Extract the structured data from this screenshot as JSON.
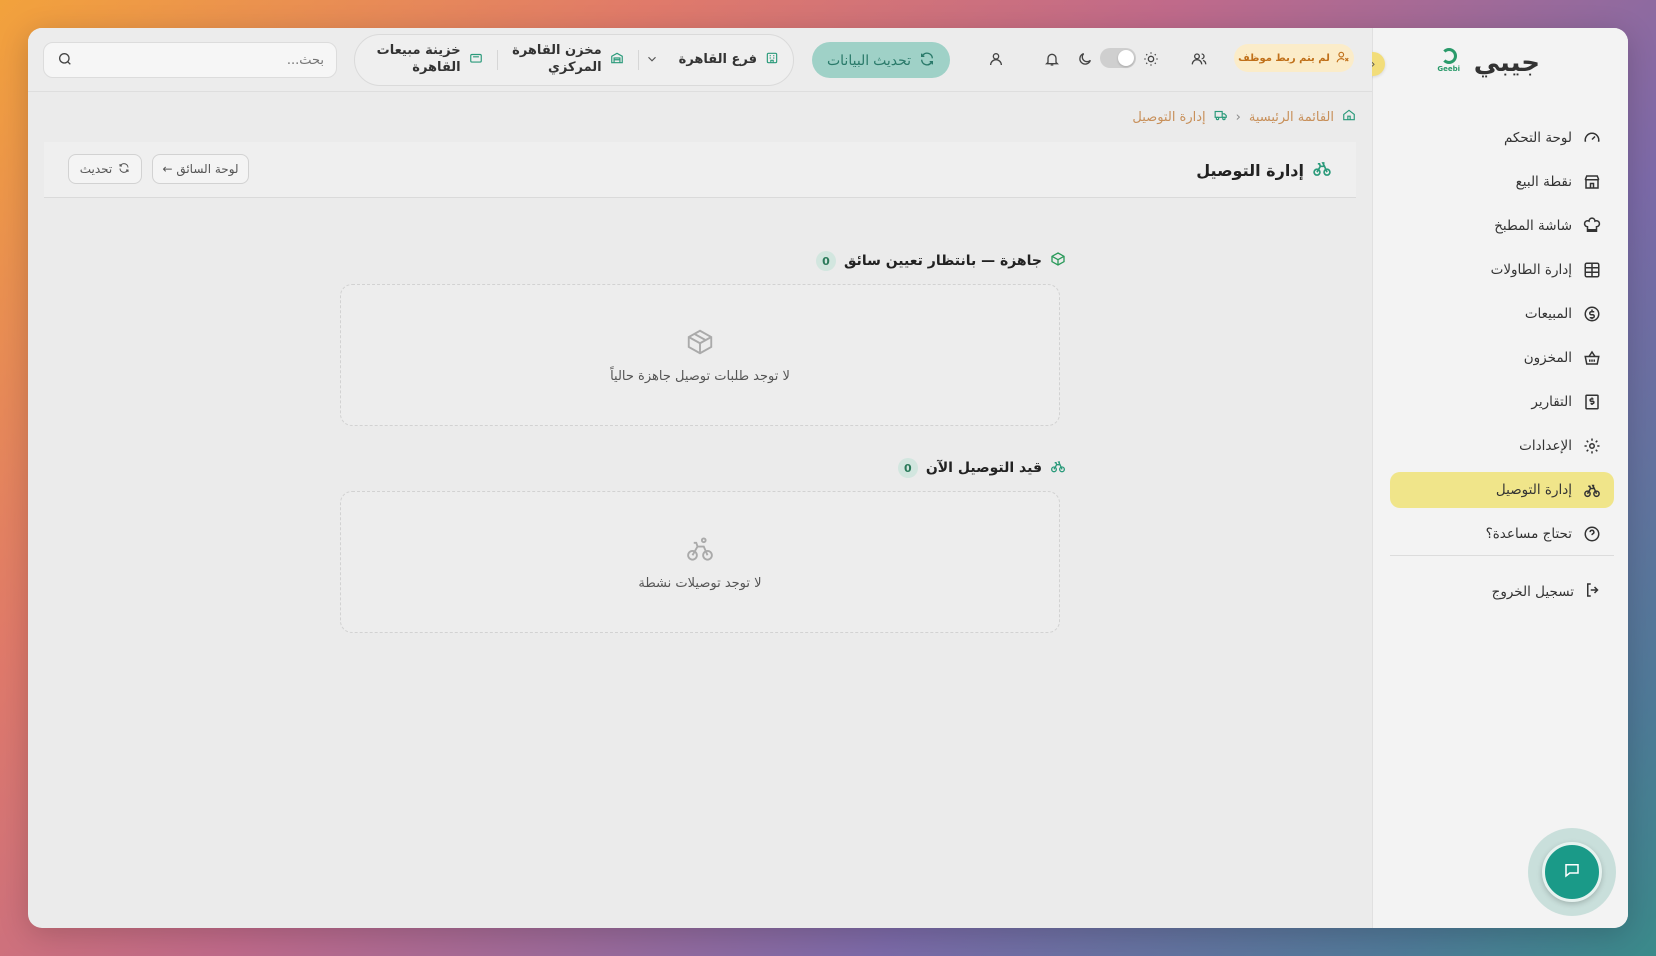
{
  "brand": {
    "name": "جيبي",
    "logo_text": "Geebi"
  },
  "sidebar": {
    "items": [
      {
        "label": "لوحة التحكم",
        "icon": "gauge-icon"
      },
      {
        "label": "نقطة البيع",
        "icon": "store-icon"
      },
      {
        "label": "شاشة المطبخ",
        "icon": "chef-hat-icon"
      },
      {
        "label": "إدارة الطاولات",
        "icon": "table-grid-icon"
      },
      {
        "label": "المبيعات",
        "icon": "dollar-circle-icon"
      },
      {
        "label": "المخزون",
        "icon": "basket-icon"
      },
      {
        "label": "التقارير",
        "icon": "receipt-icon"
      },
      {
        "label": "الإعدادات",
        "icon": "gear-icon"
      },
      {
        "label": "إدارة التوصيل",
        "icon": "bike-icon",
        "active": true
      },
      {
        "label": "تحتاج مساعدة؟",
        "icon": "help-circle-icon"
      }
    ],
    "logout": "تسجيل الخروج"
  },
  "header": {
    "search_placeholder": "بحث...",
    "treasury": "خزينة مبيعات القاهرة",
    "warehouse": "مخزن القاهرة المركزي",
    "branch": "فرع القاهرة",
    "refresh_label": "تحديث البيانات",
    "employee_badge": "لم يتم ربط موظف"
  },
  "breadcrumb": {
    "home": "القائمة الرئيسية",
    "current": "إدارة التوصيل"
  },
  "page": {
    "title": "إدارة التوصيل",
    "driver_board_btn": "لوحة السائق ←",
    "refresh_btn": "تحديث"
  },
  "sections": {
    "ready": {
      "title": "جاهزة — بانتظار تعيين سائق",
      "count": "0",
      "empty_text": "لا توجد طلبات توصيل جاهزة حالياً"
    },
    "in_delivery": {
      "title": "قيد التوصيل الآن",
      "count": "0",
      "empty_text": "لا توجد توصيلات نشطة"
    }
  },
  "colors": {
    "accent": "#1a9a88",
    "active_nav": "#f0e58a",
    "refresh_bg": "#9fd1c7"
  }
}
